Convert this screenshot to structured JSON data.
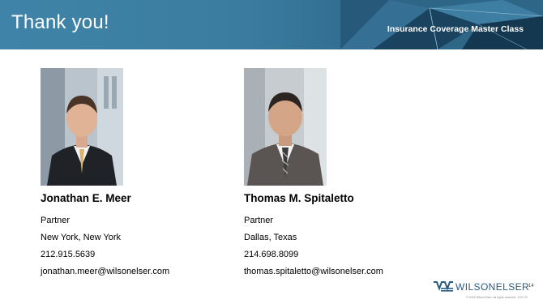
{
  "header": {
    "title": "Thank you!",
    "course": "Insurance Coverage Master Class"
  },
  "people": [
    {
      "name": "Jonathan E. Meer",
      "role": "Partner",
      "location": "New York, New York",
      "phone": "212.915.5639",
      "email": "jonathan.meer@wilsonelser.com"
    },
    {
      "name": "Thomas M. Spitaletto",
      "role": "Partner",
      "location": "Dallas, Texas",
      "phone": "214.698.8099",
      "email": "thomas.spitaletto@wilsonelser.com"
    }
  ],
  "footer": {
    "logo_text": "WILSONELSER",
    "page_number": "14",
    "copyright": "© 2023 Wilson Elser. All rights reserved. 1127-22"
  },
  "colors": {
    "header_blue": "#3a7ca0",
    "logo_blue": "#2a5b7e"
  }
}
